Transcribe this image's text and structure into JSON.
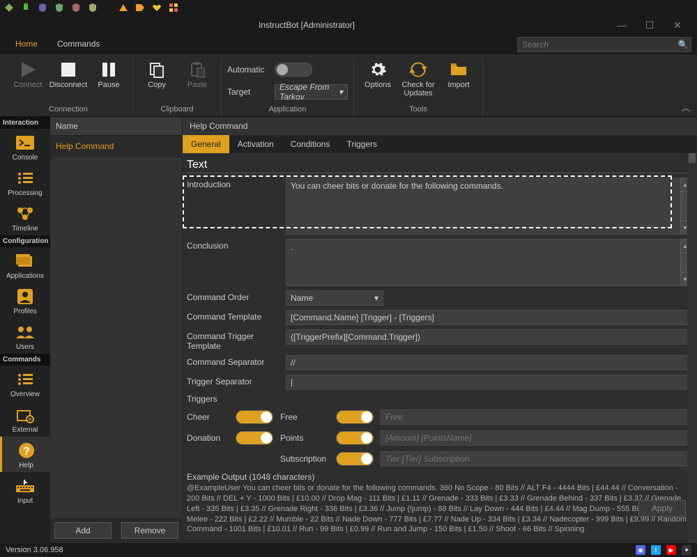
{
  "window": {
    "title": "InstructBot [Administrator]",
    "min": "—",
    "max": "☐",
    "close": "✕"
  },
  "menu": {
    "home": "Home",
    "commands": "Commands"
  },
  "search": {
    "placeholder": "Search"
  },
  "ribbon": {
    "connect": "Connect",
    "disconnect": "Disconnect",
    "pause": "Pause",
    "copy": "Copy",
    "paste": "Paste",
    "connection": "Connection",
    "clipboard": "Clipboard",
    "automatic": "Automatic",
    "target": "Target",
    "target_value": "Escape From Tarkov",
    "application": "Application",
    "options": "Options",
    "checkupdates": "Check for Updates",
    "import": "Import",
    "tools": "Tools"
  },
  "vnav": {
    "interaction": "Interaction",
    "console": "Console",
    "processing": "Processing",
    "timeline": "Timeline",
    "configuration": "Configuration",
    "applications": "Applications",
    "profiles": "Profiles",
    "users": "Users",
    "commands": "Commands",
    "overview": "Overview",
    "external": "External",
    "help": "Help",
    "input": "Input"
  },
  "cmdcol": {
    "hdr": "Name",
    "row0": "Help Command"
  },
  "editor": {
    "header": "Help Command",
    "tabs": {
      "general": "General",
      "activation": "Activation",
      "conditions": "Conditions",
      "triggers": "Triggers"
    },
    "section_text": "Text",
    "introduction_lbl": "Introduction",
    "introduction_val": "You can cheer bits or donate for the following commands.",
    "conclusion_lbl": "Conclusion",
    "conclusion_val": ".",
    "command_order_lbl": "Command Order",
    "command_order_val": "Name",
    "command_template_lbl": "Command Template",
    "command_template_val": "[Command.Name] [Trigger] - [Triggers]",
    "command_trigger_template_lbl": "Command Trigger Template",
    "command_trigger_template_val": "([TriggerPrefix][Command.Trigger])",
    "command_separator_lbl": "Command Separator",
    "command_separator_val": "//",
    "trigger_separator_lbl": "Trigger Separator",
    "trigger_separator_val": "|",
    "triggers_hdr": "Triggers",
    "cheer_lbl": "Cheer",
    "donation_lbl": "Donation",
    "free_lbl": "Free",
    "points_lbl": "Points",
    "subscription_lbl": "Subscription",
    "free_placeholder": "Free",
    "points_placeholder": "[Amount] [PointsName]",
    "subscription_placeholder": "Tier [Tier] Subscription",
    "example_lbl": "Example Output (1048 characters)",
    "example_text": "@ExampleUser You can cheer bits or donate for the following commands. 360 No Scope  - 80 Bits // ALT F4  - 4444 Bits | £44.44 // Conversation  - 200 Bits // DEL + Y  - 1000 Bits | £10.00 // Drop Mag  - 111 Bits | £1.11 // Grenade  - 333 Bits | £3.33 // Grenade Behind  - 337 Bits | £3.37 // Grenade Left  - 335 Bits | £3.35 // Grenade Right  - 336 Bits | £3.36 // Jump  (!jump) - 88 Bits // Lay Down  - 444 Bits | £4.44 // Mag Dump  - 555 Bits | £5.55 // Melee  - 222 Bits | £2.22 // Mumble  - 22 Bits // Nade Down  - 777 Bits | £7.77 // Nade Up  - 334 Bits | £3.34 // Nadecopter  - 999 Bits | £9.99 // Random Command  - 1001 Bits | £10.01 // Run  - 99 Bits | £0.99 // Run and Jump  - 150 Bits | £1.50 // Shoot  - 66 Bits // Spinning"
  },
  "actions": {
    "add": "Add",
    "remove": "Remove",
    "apply": "Apply"
  },
  "status": {
    "version": "Version 3.06.958"
  }
}
